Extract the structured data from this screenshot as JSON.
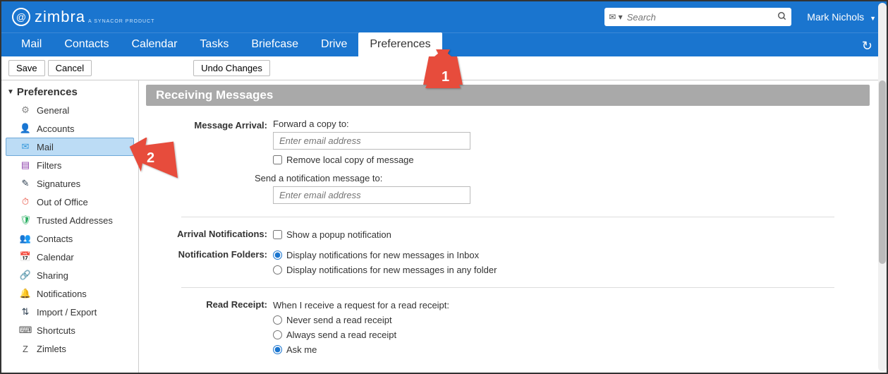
{
  "brand": {
    "name": "zimbra",
    "subtitle": "A SYNACOR PRODUCT"
  },
  "search": {
    "placeholder": "Search"
  },
  "user": {
    "name": "Mark Nichols"
  },
  "tabs": [
    "Mail",
    "Contacts",
    "Calendar",
    "Tasks",
    "Briefcase",
    "Drive",
    "Preferences"
  ],
  "active_tab": "Preferences",
  "toolbar": {
    "save": "Save",
    "cancel": "Cancel",
    "undo": "Undo Changes"
  },
  "sidebar": {
    "title": "Preferences",
    "items": [
      {
        "icon": "⚙",
        "label": "General",
        "color": "#888"
      },
      {
        "icon": "👤",
        "label": "Accounts",
        "color": "#c0392b"
      },
      {
        "icon": "✉",
        "label": "Mail",
        "color": "#3498db",
        "selected": true
      },
      {
        "icon": "▤",
        "label": "Filters",
        "color": "#8e44ad"
      },
      {
        "icon": "✎",
        "label": "Signatures",
        "color": "#2c3e50"
      },
      {
        "icon": "⏱",
        "label": "Out of Office",
        "color": "#e74c3c"
      },
      {
        "icon": "🛡",
        "label": "Trusted Addresses",
        "color": "#27ae60"
      },
      {
        "icon": "👥",
        "label": "Contacts",
        "color": "#2980b9"
      },
      {
        "icon": "📅",
        "label": "Calendar",
        "color": "#2980b9"
      },
      {
        "icon": "🔗",
        "label": "Sharing",
        "color": "#e67e22"
      },
      {
        "icon": "🔔",
        "label": "Notifications",
        "color": "#f1c40f"
      },
      {
        "icon": "⇅",
        "label": "Import / Export",
        "color": "#2c3e50"
      },
      {
        "icon": "⌨",
        "label": "Shortcuts",
        "color": "#555"
      },
      {
        "icon": "Z",
        "label": "Zimlets",
        "color": "#555"
      }
    ]
  },
  "section": {
    "title": "Receiving Messages",
    "message_arrival": {
      "label": "Message Arrival:",
      "forward_text": "Forward a copy to:",
      "forward_placeholder": "Enter email address",
      "remove_local": "Remove local copy of message",
      "notify_text": "Send a notification message to:",
      "notify_placeholder": "Enter email address"
    },
    "arrival_notifications": {
      "label": "Arrival Notifications:",
      "popup": "Show a popup notification"
    },
    "notification_folders": {
      "label": "Notification Folders:",
      "inbox": "Display notifications for new messages in Inbox",
      "any": "Display notifications for new messages in any folder",
      "selected": "inbox"
    },
    "read_receipt": {
      "label": "Read Receipt:",
      "intro": "When I receive a request for a read receipt:",
      "never": "Never send a read receipt",
      "always": "Always send a read receipt",
      "ask": "Ask me",
      "selected": "ask"
    }
  },
  "annotations": {
    "arrow1": "1",
    "arrow2": "2"
  }
}
